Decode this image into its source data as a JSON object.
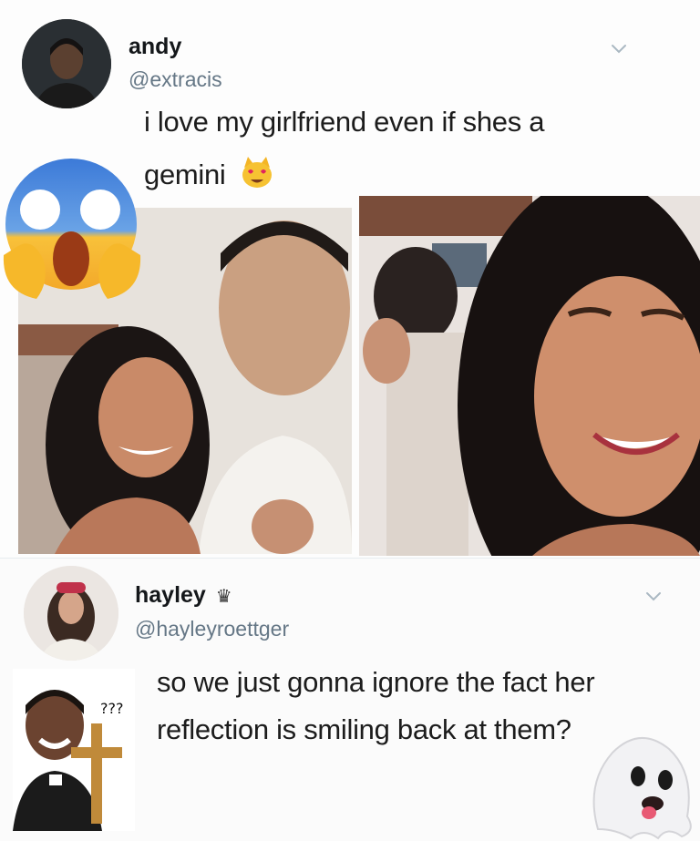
{
  "tweet1": {
    "name": "andy",
    "handle": "@extracis",
    "text_line1": "i love my girlfriend even if shes a",
    "text_line2": "gemini",
    "emoji": "heart-eyes-cat-emoji"
  },
  "tweet2": {
    "name": "hayley",
    "badge": "♛",
    "handle": "@hayleyroettger",
    "text_line1": "so we just gonna ignore the fact her",
    "text_line2": "reflection is smiling back at them?",
    "sticker_text": "???"
  },
  "overlay": {
    "scream_emoji": "screaming-face-emoji",
    "ghost_emoji": "ghost-emoji"
  },
  "colors": {
    "name": "#14171a",
    "handle": "#657786",
    "chevron": "#aab8c2"
  }
}
